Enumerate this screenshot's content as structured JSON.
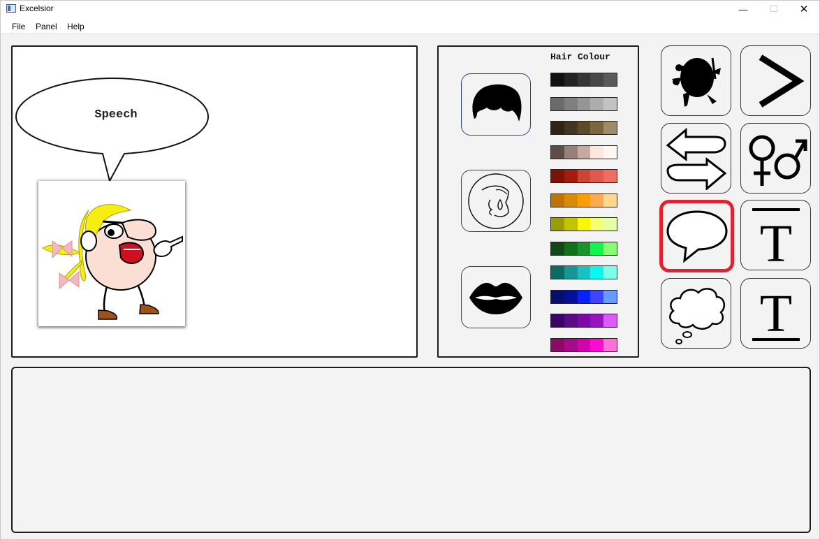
{
  "window": {
    "title": "Excelsior",
    "minimize": "—",
    "maximize": "☐",
    "close": "✕"
  },
  "menu": [
    "File",
    "Panel",
    "Help"
  ],
  "canvas": {
    "bubble_text": "Speech"
  },
  "customise": {
    "hair_colour_label": "Hair Colour",
    "swatches": [
      [
        "#111111",
        "#232323",
        "#353535",
        "#474747",
        "#595959"
      ],
      [
        "#6b6b6b",
        "#7f7f7f",
        "#969696",
        "#adadad",
        "#c3c3c3"
      ],
      [
        "#2e2418",
        "#433520",
        "#5d4a26",
        "#7c6640",
        "#a08a6e"
      ],
      [
        "#5e4c46",
        "#98807a",
        "#c6aaa0",
        "#fde8e1",
        "#fff6f3"
      ],
      [
        "#7c1304",
        "#a11d0c",
        "#cc4434",
        "#df5a4c",
        "#ef6e64"
      ],
      [
        "#c07406",
        "#d98c06",
        "#fb9e03",
        "#ffaa4e",
        "#ffd88e"
      ],
      [
        "#9c9c08",
        "#c2c404",
        "#f8f802",
        "#f4ff72",
        "#e4ffa8"
      ],
      [
        "#0f4a16",
        "#127018",
        "#18942c",
        "#13f44e",
        "#86fc74"
      ],
      [
        "#0c6a64",
        "#169696",
        "#17c2c3",
        "#0af6ee",
        "#7cfde7"
      ],
      [
        "#04106a",
        "#060e9a",
        "#0822ff",
        "#3f44ff",
        "#689bff"
      ],
      [
        "#3c0466",
        "#590c86",
        "#7e07a8",
        "#9b12c2",
        "#dd5aff"
      ],
      [
        "#8b0a64",
        "#a60c8a",
        "#d203aa",
        "#fd0acf",
        "#fd70d8"
      ]
    ]
  },
  "tools": [
    "character-select",
    "next-arrow",
    "swap-direction",
    "gender-toggle",
    "speech-bubble",
    "overline-text",
    "thought-bubble",
    "underline-text"
  ]
}
